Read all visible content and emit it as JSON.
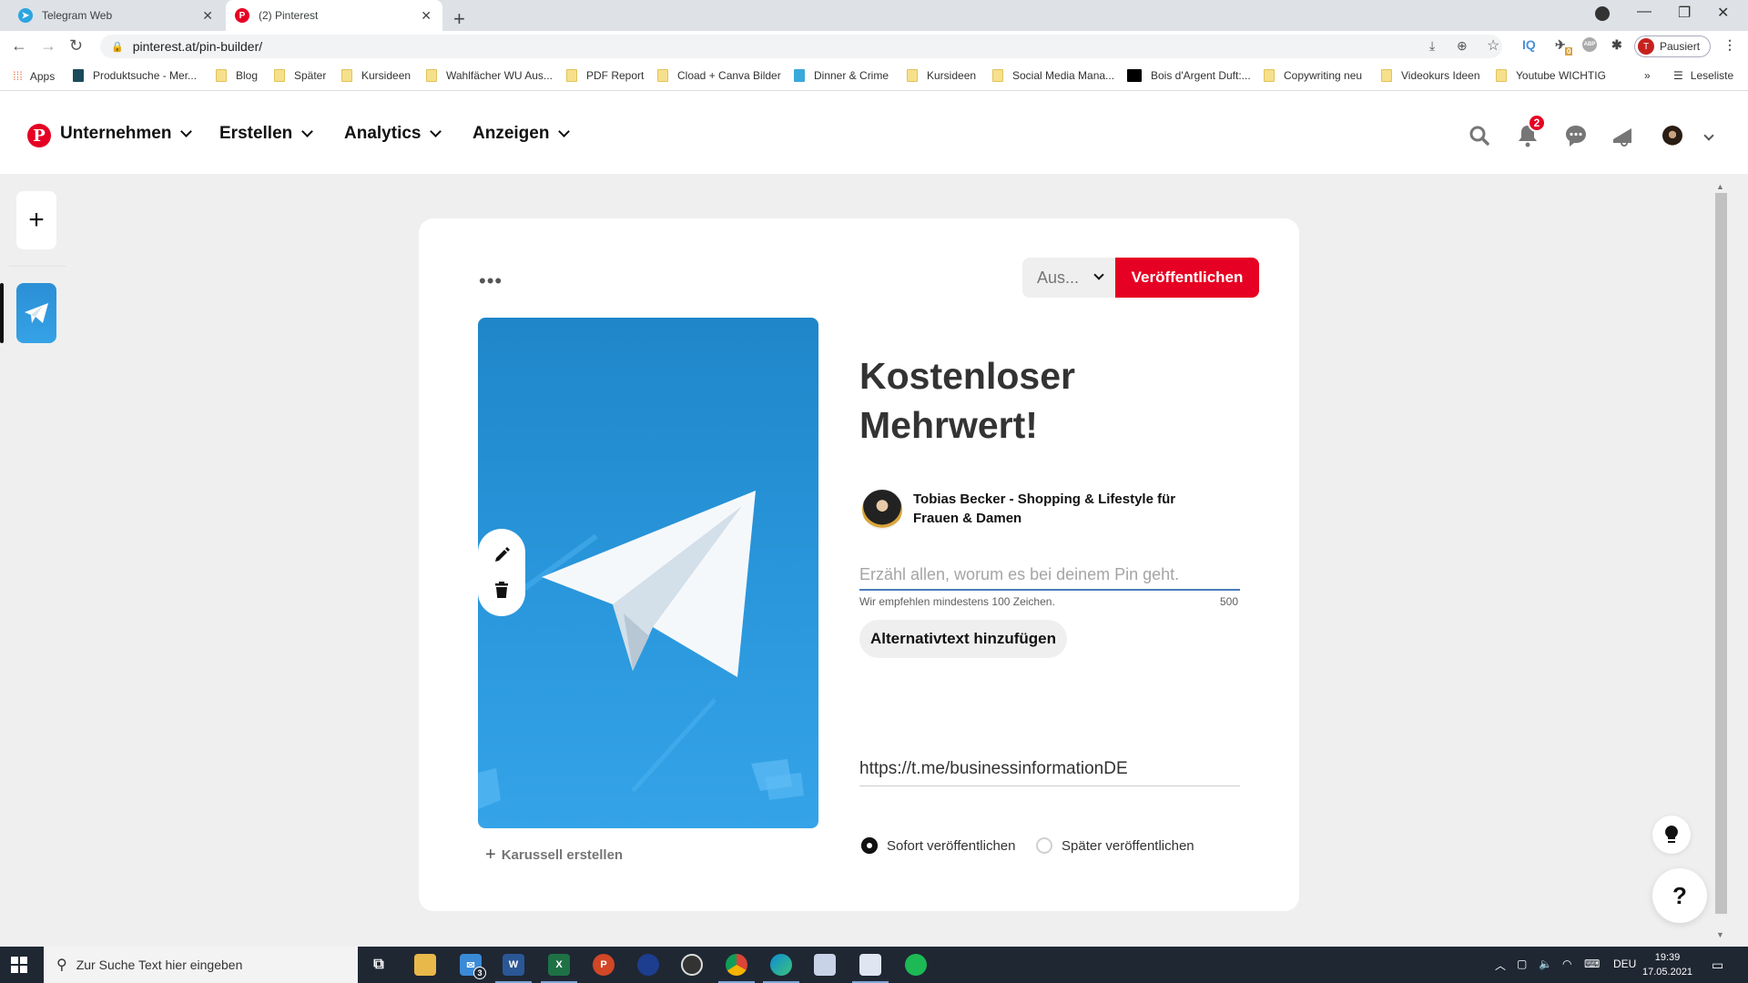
{
  "browser": {
    "tabs": [
      {
        "title": "Telegram Web",
        "icon": "telegram-icon",
        "active": false
      },
      {
        "title": "(2) Pinterest",
        "icon": "pinterest-icon",
        "active": true
      }
    ],
    "url": "pinterest.at/pin-builder/",
    "profile_label": "Pausiert",
    "profile_initial": "T",
    "extension_badge": "0",
    "bookmarks": [
      {
        "label": "Apps",
        "icon": "apps-grid-icon"
      },
      {
        "label": "Produktsuche - Mer...",
        "icon": "shirt-icon"
      },
      {
        "label": "Blog",
        "icon": "folder-icon"
      },
      {
        "label": "Später",
        "icon": "folder-icon"
      },
      {
        "label": "Kursideen",
        "icon": "folder-icon"
      },
      {
        "label": "Wahlfächer WU Aus...",
        "icon": "folder-icon"
      },
      {
        "label": "PDF Report",
        "icon": "folder-icon"
      },
      {
        "label": "Cload + Canva Bilder",
        "icon": "folder-icon"
      },
      {
        "label": "Dinner & Crime",
        "icon": "jd-icon"
      },
      {
        "label": "Kursideen",
        "icon": "folder-icon"
      },
      {
        "label": "Social Media Mana...",
        "icon": "folder-icon"
      },
      {
        "label": "Bois d'Argent Duft:...",
        "icon": "site-icon"
      },
      {
        "label": "Copywriting neu",
        "icon": "folder-icon"
      },
      {
        "label": "Videokurs Ideen",
        "icon": "folder-icon"
      },
      {
        "label": "Youtube WICHTIG",
        "icon": "folder-icon"
      }
    ],
    "overflow_label": "»",
    "reading_list_label": "Leseliste"
  },
  "pinterest": {
    "nav": [
      {
        "label": "Unternehmen"
      },
      {
        "label": "Erstellen"
      },
      {
        "label": "Analytics"
      },
      {
        "label": "Anzeigen"
      }
    ],
    "notification_count": "2",
    "brand_color": "#e60023"
  },
  "pin_builder": {
    "more_options": "•••",
    "board_select": "Aus...",
    "publish_label": "Veröffentlichen",
    "title": "Kostenloser Mehrwert!",
    "author_name": "Tobias Becker - Shopping & Lifestyle für Frauen & Damen",
    "description_placeholder": "Erzähl allen, worum es bei deinem Pin geht.",
    "description_value": "",
    "hint": "Wir empfehlen mindestens 100 Zeichen.",
    "char_counter": "500",
    "alt_text_button": "Alternativtext hinzufügen",
    "link_value": "https://t.me/businessinformationDE",
    "carousel_label": "Karussell erstellen",
    "publish_options": [
      {
        "label": "Sofort veröffentlichen",
        "selected": true
      },
      {
        "label": "Später veröffentlichen",
        "selected": false
      }
    ]
  },
  "floating": {
    "help_label": "?"
  },
  "taskbar": {
    "search_placeholder": "Zur Suche Text hier eingeben",
    "mail_badge": "3",
    "language": "DEU",
    "time": "19:39",
    "date": "17.05.2021"
  }
}
